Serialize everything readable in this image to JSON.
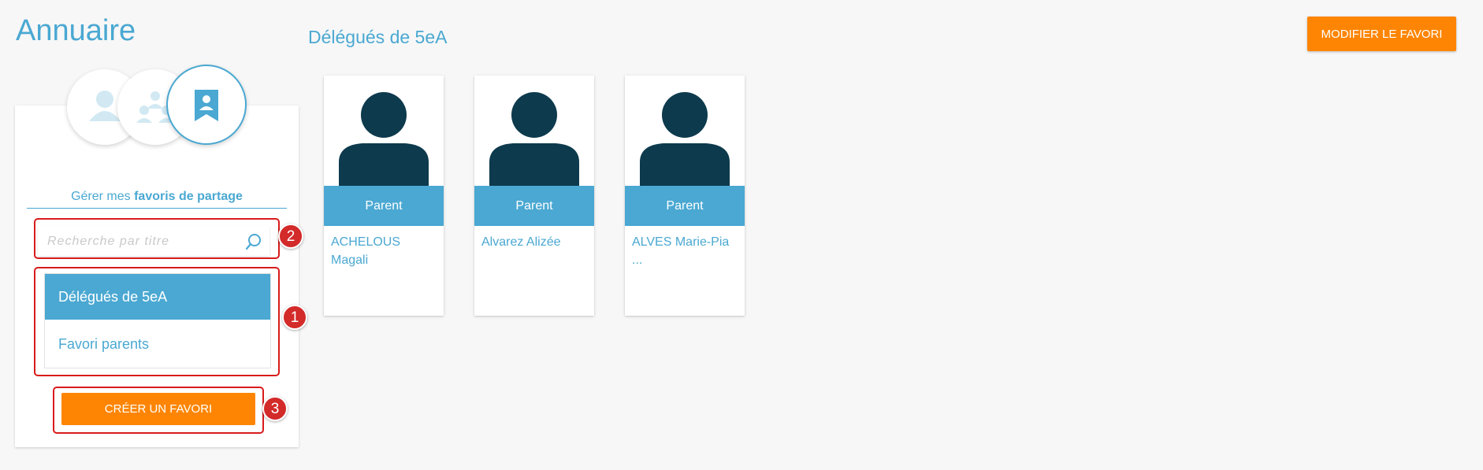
{
  "header": {
    "app_title": "Annuaire",
    "group_title": "Délégués de 5eA",
    "edit_button_label": "MODIFIER LE FAVORI"
  },
  "sidebar": {
    "mode_icons": [
      "person-icon",
      "group-icon",
      "bookmark-person-icon"
    ],
    "heading_prefix": "Gérer mes",
    "heading_bold": "favoris de partage",
    "search": {
      "placeholder": "Recherche par titre",
      "value": ""
    },
    "favorites": [
      {
        "label": "Délégués de 5eA",
        "selected": true
      },
      {
        "label": "Favori parents",
        "selected": false
      }
    ],
    "create_button_label": "CRÉER UN FAVORI"
  },
  "annotations": [
    "1",
    "2",
    "3"
  ],
  "cards": [
    {
      "role": "Parent",
      "name": "ACHELOUS Magali"
    },
    {
      "role": "Parent",
      "name": "Alvarez Alizée"
    },
    {
      "role": "Parent",
      "name": "ALVES Marie-Pia ..."
    }
  ],
  "colors": {
    "accent_blue": "#4aa8d2",
    "orange": "#fd8503",
    "avatar_dark": "#0d3a4d",
    "annotation_red": "#d32a2a"
  }
}
